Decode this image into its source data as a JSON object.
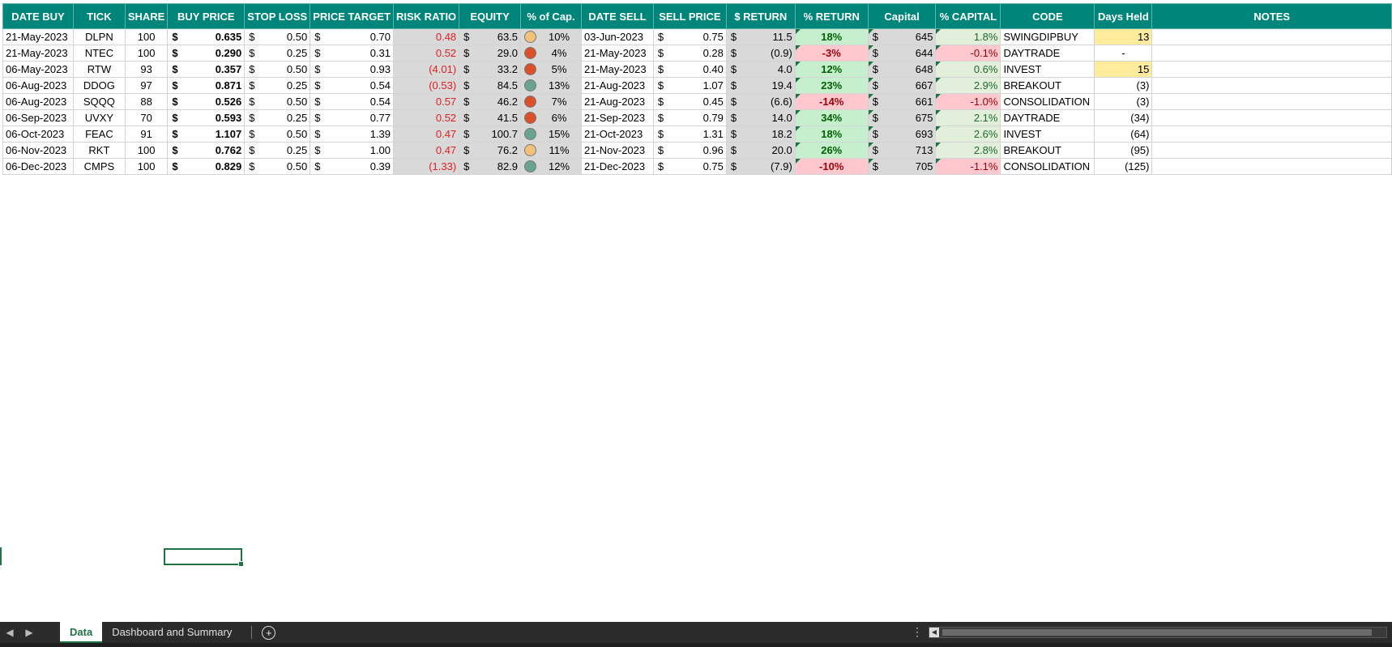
{
  "columns": [
    "DATE BUY",
    "TICK",
    "SHARE",
    "BUY PRICE",
    "STOP LOSS",
    "PRICE TARGET",
    "RISK RATIO",
    "EQUITY",
    "% of Cap.",
    "DATE SELL",
    "SELL PRICE",
    "$ RETURN",
    "% RETURN",
    "Capital",
    "% CAPITAL",
    "CODE",
    "Days Held",
    "NOTES"
  ],
  "currency_symbol": "$",
  "rows": [
    {
      "date_buy": "21-May-2023",
      "tick": "DLPN",
      "share": "100",
      "buy_price": "0.635",
      "stop_loss": "0.50",
      "price_target": "0.70",
      "risk_ratio": "0.48",
      "equity": "63.5",
      "pct_cap": "10%",
      "pct_cap_status": "yellow",
      "date_sell": "03-Jun-2023",
      "sell_price": "0.75",
      "dollar_return": "11.5",
      "pct_return": "18%",
      "return_sign": "pos",
      "capital": "645",
      "pct_capital": "1.8%",
      "capital_sign": "pos",
      "code": "SWINGDIPBUY",
      "days_held": "13",
      "days_highlight": true
    },
    {
      "date_buy": "21-May-2023",
      "tick": "NTEC",
      "share": "100",
      "buy_price": "0.290",
      "stop_loss": "0.25",
      "price_target": "0.31",
      "risk_ratio": "0.52",
      "equity": "29.0",
      "pct_cap": "4%",
      "pct_cap_status": "red",
      "date_sell": "21-May-2023",
      "sell_price": "0.28",
      "dollar_return": "(0.9)",
      "pct_return": "-3%",
      "return_sign": "neg",
      "capital": "644",
      "pct_capital": "-0.1%",
      "capital_sign": "neg",
      "code": "DAYTRADE",
      "days_held": "-",
      "days_highlight": false
    },
    {
      "date_buy": "06-May-2023",
      "tick": "RTW",
      "share": "93",
      "buy_price": "0.357",
      "stop_loss": "0.50",
      "price_target": "0.93",
      "risk_ratio": "(4.01)",
      "equity": "33.2",
      "pct_cap": "5%",
      "pct_cap_status": "red",
      "date_sell": "21-May-2023",
      "sell_price": "0.40",
      "dollar_return": "4.0",
      "pct_return": "12%",
      "return_sign": "pos",
      "capital": "648",
      "pct_capital": "0.6%",
      "capital_sign": "pos",
      "code": "INVEST",
      "days_held": "15",
      "days_highlight": true
    },
    {
      "date_buy": "06-Aug-2023",
      "tick": "DDOG",
      "share": "97",
      "buy_price": "0.871",
      "stop_loss": "0.25",
      "price_target": "0.54",
      "risk_ratio": "(0.53)",
      "equity": "84.5",
      "pct_cap": "13%",
      "pct_cap_status": "green",
      "date_sell": "21-Aug-2023",
      "sell_price": "1.07",
      "dollar_return": "19.4",
      "pct_return": "23%",
      "return_sign": "pos",
      "capital": "667",
      "pct_capital": "2.9%",
      "capital_sign": "pos",
      "code": "BREAKOUT",
      "days_held": "(3)",
      "days_highlight": false
    },
    {
      "date_buy": "06-Aug-2023",
      "tick": "SQQQ",
      "share": "88",
      "buy_price": "0.526",
      "stop_loss": "0.50",
      "price_target": "0.54",
      "risk_ratio": "0.57",
      "equity": "46.2",
      "pct_cap": "7%",
      "pct_cap_status": "red",
      "date_sell": "21-Aug-2023",
      "sell_price": "0.45",
      "dollar_return": "(6.6)",
      "pct_return": "-14%",
      "return_sign": "neg",
      "capital": "661",
      "pct_capital": "-1.0%",
      "capital_sign": "neg",
      "code": "CONSOLIDATION",
      "days_held": "(3)",
      "days_highlight": false
    },
    {
      "date_buy": "06-Sep-2023",
      "tick": "UVXY",
      "share": "70",
      "buy_price": "0.593",
      "stop_loss": "0.25",
      "price_target": "0.77",
      "risk_ratio": "0.52",
      "equity": "41.5",
      "pct_cap": "6%",
      "pct_cap_status": "red",
      "date_sell": "21-Sep-2023",
      "sell_price": "0.79",
      "dollar_return": "14.0",
      "pct_return": "34%",
      "return_sign": "pos",
      "capital": "675",
      "pct_capital": "2.1%",
      "capital_sign": "pos",
      "code": "DAYTRADE",
      "days_held": "(34)",
      "days_highlight": false
    },
    {
      "date_buy": "06-Oct-2023",
      "tick": "FEAC",
      "share": "91",
      "buy_price": "1.107",
      "stop_loss": "0.50",
      "price_target": "1.39",
      "risk_ratio": "0.47",
      "equity": "100.7",
      "pct_cap": "15%",
      "pct_cap_status": "green",
      "date_sell": "21-Oct-2023",
      "sell_price": "1.31",
      "dollar_return": "18.2",
      "pct_return": "18%",
      "return_sign": "pos",
      "capital": "693",
      "pct_capital": "2.6%",
      "capital_sign": "pos",
      "code": "INVEST",
      "days_held": "(64)",
      "days_highlight": false
    },
    {
      "date_buy": "06-Nov-2023",
      "tick": "RKT",
      "share": "100",
      "buy_price": "0.762",
      "stop_loss": "0.25",
      "price_target": "1.00",
      "risk_ratio": "0.47",
      "equity": "76.2",
      "pct_cap": "11%",
      "pct_cap_status": "yellow",
      "date_sell": "21-Nov-2023",
      "sell_price": "0.96",
      "dollar_return": "20.0",
      "pct_return": "26%",
      "return_sign": "pos",
      "capital": "713",
      "pct_capital": "2.8%",
      "capital_sign": "pos",
      "code": "BREAKOUT",
      "days_held": "(95)",
      "days_highlight": false
    },
    {
      "date_buy": "06-Dec-2023",
      "tick": "CMPS",
      "share": "100",
      "buy_price": "0.829",
      "stop_loss": "0.50",
      "price_target": "0.39",
      "risk_ratio": "(1.33)",
      "equity": "82.9",
      "pct_cap": "12%",
      "pct_cap_status": "green",
      "date_sell": "21-Dec-2023",
      "sell_price": "0.75",
      "dollar_return": "(7.9)",
      "pct_return": "-10%",
      "return_sign": "neg",
      "capital": "705",
      "pct_capital": "-1.1%",
      "capital_sign": "neg",
      "code": "CONSOLIDATION",
      "days_held": "(125)",
      "days_highlight": false
    }
  ],
  "sheet_tabs": [
    {
      "label": "Data",
      "active": true
    },
    {
      "label": "Dashboard and Summary",
      "active": false
    }
  ],
  "icons": {
    "prev_sheet": "chevron-left-icon",
    "next_sheet": "chevron-right-icon",
    "add_sheet": "plus-circle-icon",
    "more": "vertical-dots-icon"
  },
  "colors": {
    "header_bg": "#00857a",
    "positive_fill": "#c6efce",
    "negative_fill": "#ffc7ce",
    "highlight_yellow": "#ffeb9c",
    "risk_red": "#e02020",
    "status_yellow": "#f2c27a",
    "status_red": "#d9502b",
    "status_green": "#6ba392"
  }
}
